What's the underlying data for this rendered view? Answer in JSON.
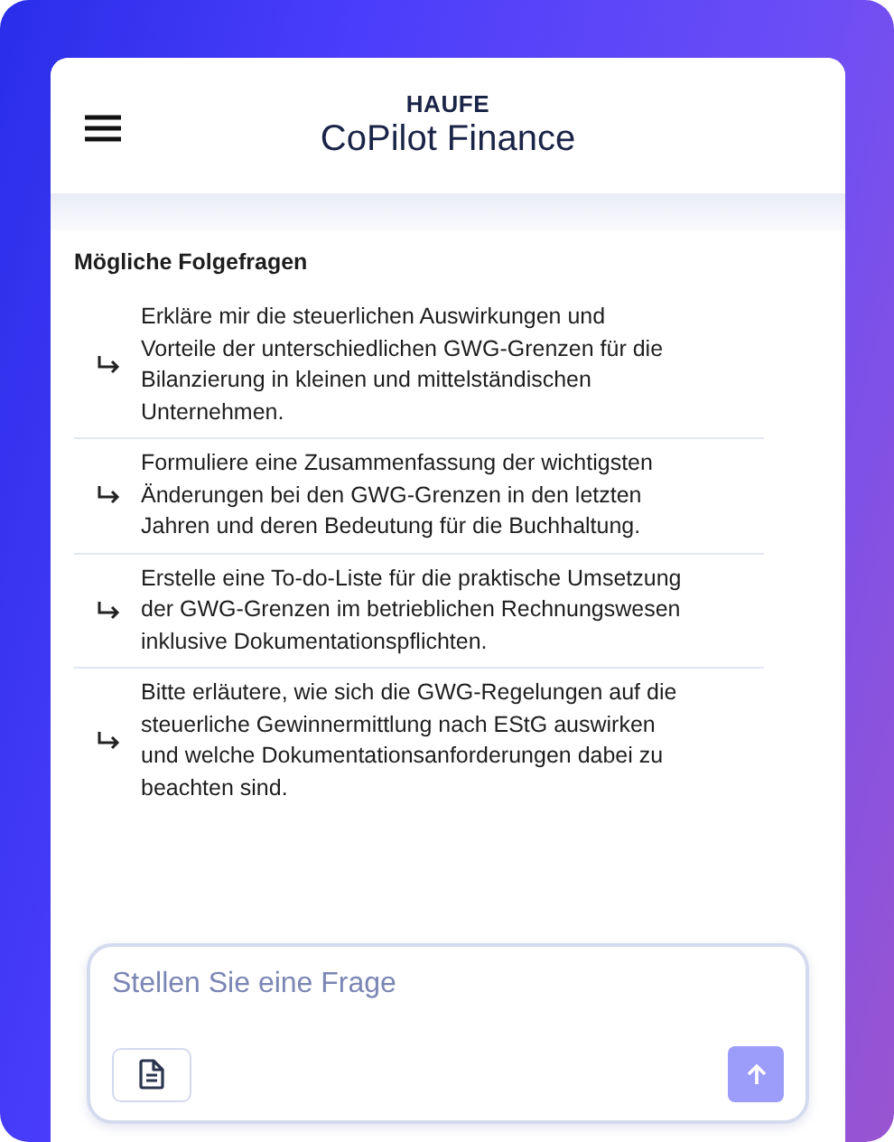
{
  "header": {
    "brand": "HAUFE",
    "title": "CoPilot Finance"
  },
  "followups": {
    "heading": "Mögliche Folgefragen",
    "items": [
      {
        "text": "Erkläre mir die steuerlichen Auswirkungen und Vorteile der unterschiedlichen GWG-Grenzen für die Bilanzierung in kleinen und mittelständischen Unternehmen."
      },
      {
        "text": "Formuliere eine Zusammenfassung der wichtigsten Änderungen bei den GWG-Grenzen in den letzten Jahren und deren Bedeutung für die Buchhaltung."
      },
      {
        "text": "Erstelle eine To-do-Liste für die praktische Umsetzung der GWG-Grenzen im betrieblichen Rechnungswesen inklusive Dokumentationspflichten."
      },
      {
        "text": "Bitte erläutere, wie sich die GWG-Regelungen auf die steuerliche Gewinnermittlung nach EStG auswirken und welche Dokumentationsanforderungen dabei zu beachten sind."
      }
    ]
  },
  "composer": {
    "placeholder": "Stellen Sie eine Frage",
    "send_disabled": true
  }
}
